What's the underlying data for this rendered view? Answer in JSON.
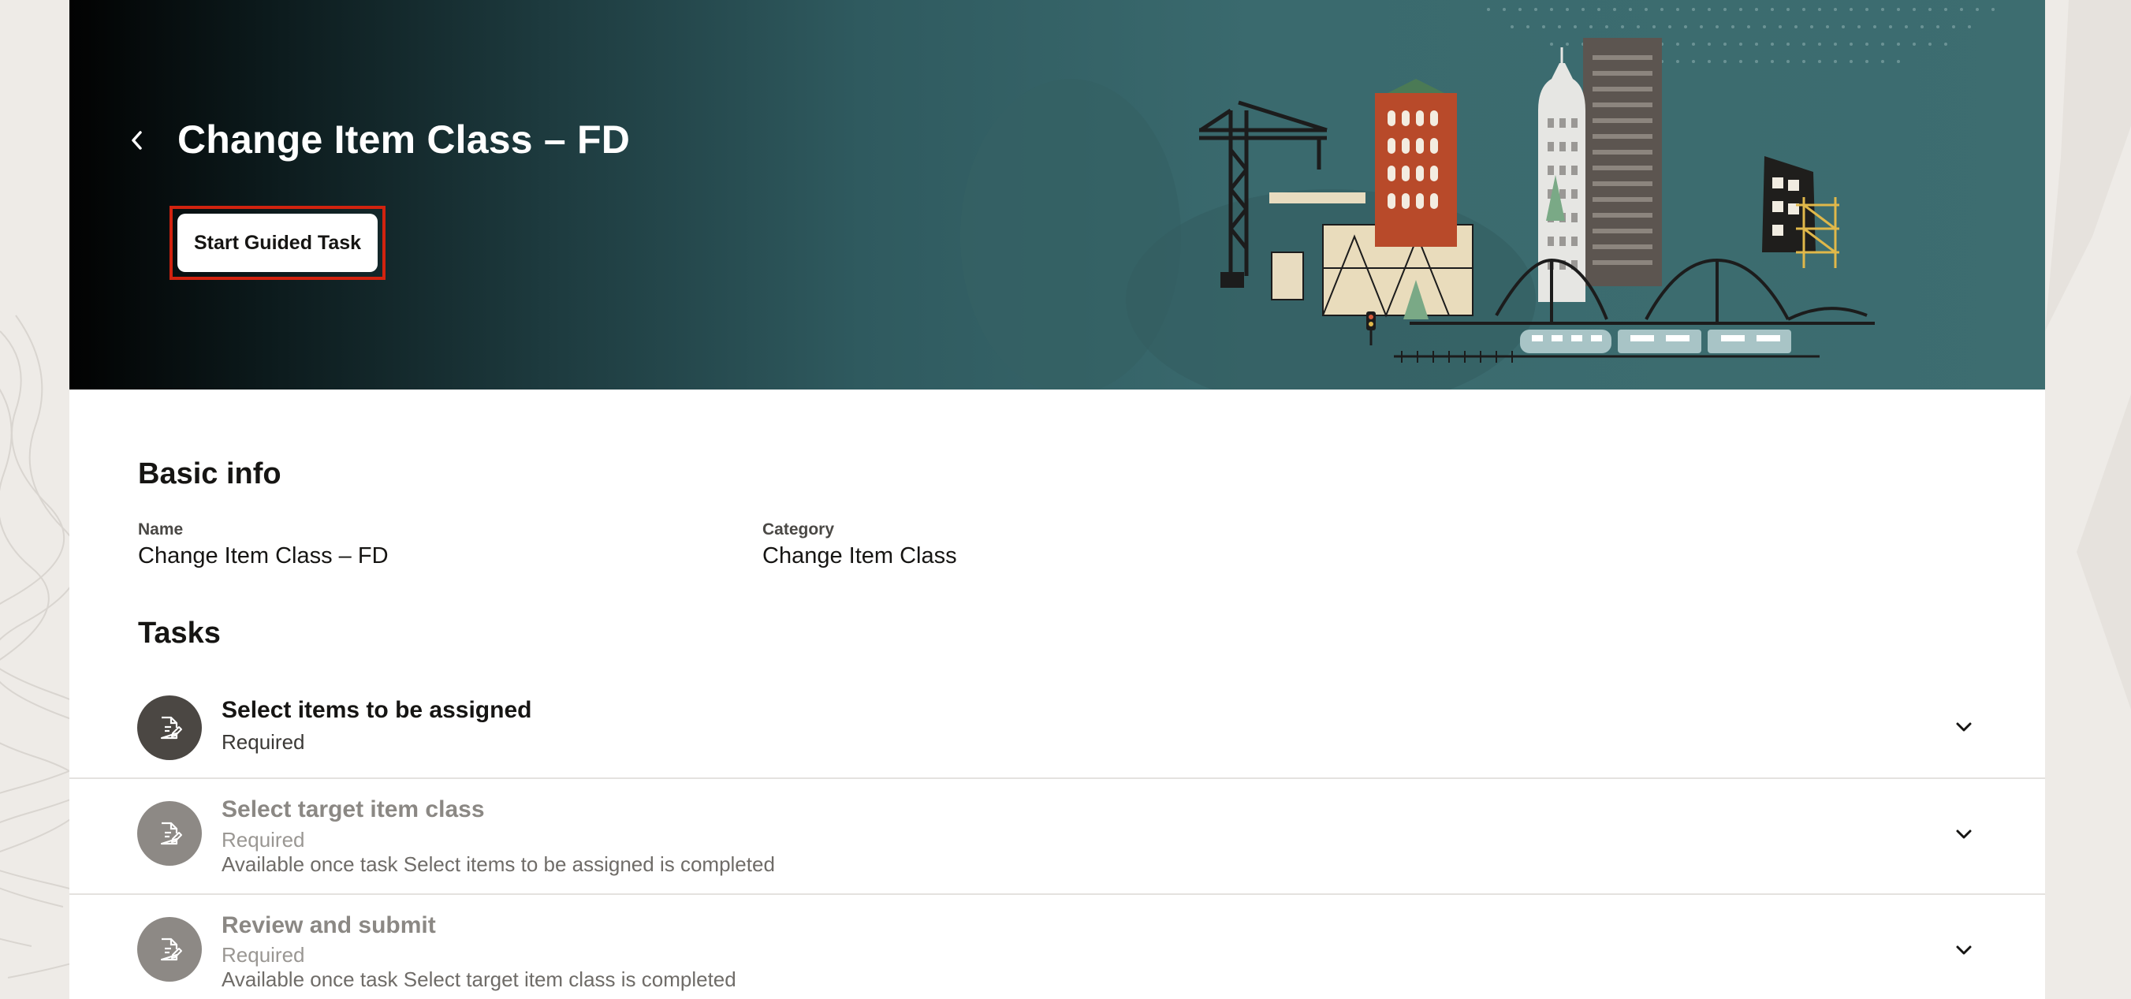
{
  "header": {
    "title": "Change Item Class – FD",
    "back_icon": "chevron-left-icon",
    "start_button_label": "Start Guided Task"
  },
  "basic_info": {
    "heading": "Basic info",
    "name_label": "Name",
    "name_value": "Change Item Class – FD",
    "category_label": "Category",
    "category_value": "Change Item Class"
  },
  "tasks": {
    "heading": "Tasks",
    "items": [
      {
        "title": "Select items to be assigned",
        "status": "Required",
        "note": "",
        "state": "active",
        "icon": "document-edit-icon"
      },
      {
        "title": "Select target item class",
        "status": "Required",
        "note": "Available once task Select items to be assigned is completed",
        "state": "disabled",
        "icon": "document-edit-icon"
      },
      {
        "title": "Review and submit",
        "status": "Required",
        "note": "Available once task Select target item class is completed",
        "state": "disabled",
        "icon": "document-edit-icon"
      }
    ]
  },
  "colors": {
    "banner_teal": "#3d6d70",
    "highlight_border": "#d2230f",
    "active_icon_bg": "#4b4743",
    "disabled_icon_bg": "#8d8985"
  }
}
